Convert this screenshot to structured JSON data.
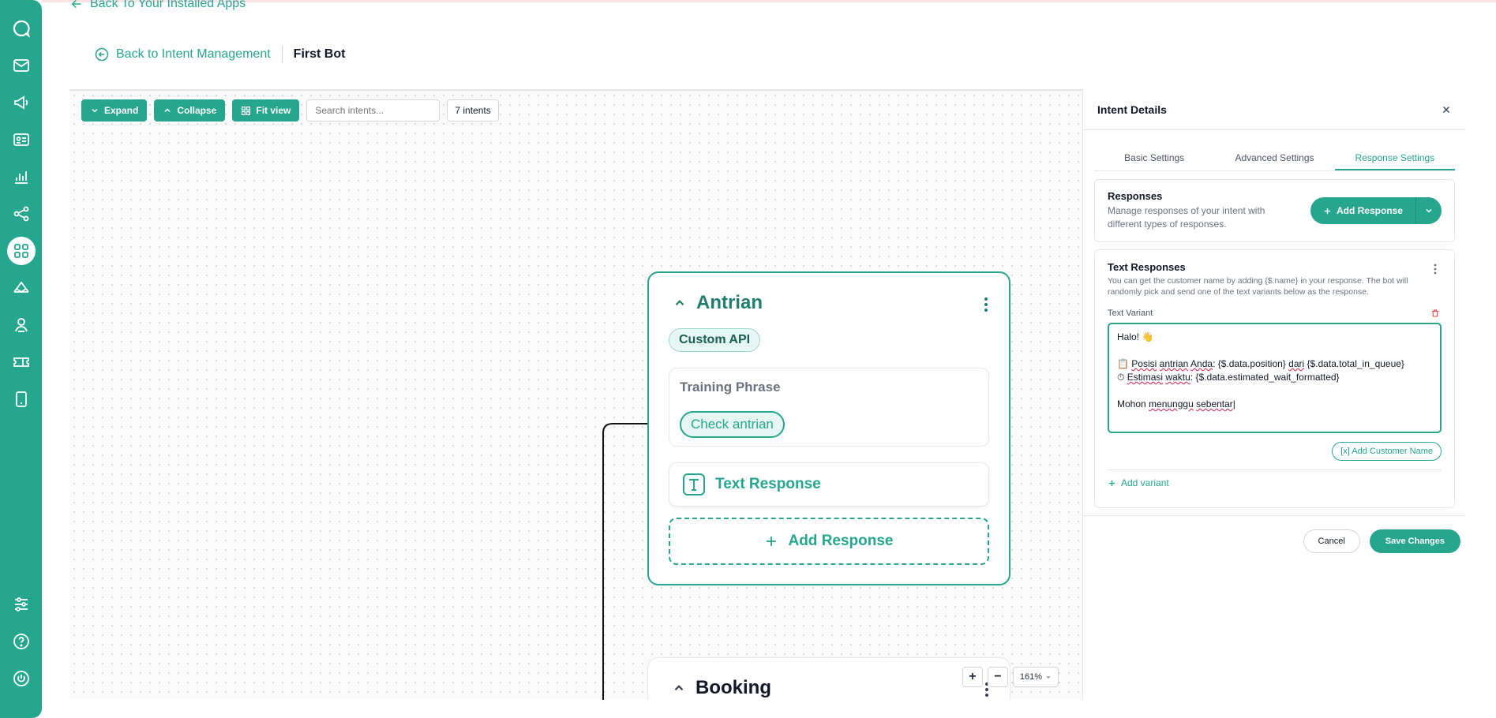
{
  "nav": {
    "back_apps": "Back To Your Installed Apps",
    "back_intent": "Back to Intent Management",
    "bot_name": "First Bot"
  },
  "sidebar": {
    "items": [
      "chat-logo-icon",
      "inbox-icon",
      "broadcast-icon",
      "contacts-icon",
      "analytics-icon",
      "integrations-icon",
      "apps-icon",
      "channels-icon",
      "agents-icon",
      "tickets-icon",
      "mobile-icon",
      "settings-icon",
      "help-icon",
      "power-icon"
    ],
    "active": "apps-icon",
    "color": "#26a68f"
  },
  "toolbar": {
    "expand": "Expand",
    "collapse": "Collapse",
    "fit_view": "Fit view",
    "search_placeholder": "Search intents...",
    "count": "7 intents"
  },
  "nodes": [
    {
      "title": "Antrian",
      "tag": "Custom API",
      "training_label": "Training Phrase",
      "training_phrase": "Check antrian",
      "response_label": "Text Response",
      "add_response": "Add Response"
    },
    {
      "title": "Booking"
    }
  ],
  "zoom": {
    "plus": "+",
    "minus": "−",
    "value": "161%"
  },
  "panel": {
    "title": "Intent Details",
    "tabs": [
      "Basic Settings",
      "Advanced Settings",
      "Response Settings"
    ],
    "active_tab": "Response Settings",
    "responses": {
      "title": "Responses",
      "desc": "Manage responses of your intent with different types of responses.",
      "add": "Add Response"
    },
    "text_responses": {
      "title": "Text Responses",
      "desc": "You can get the customer name by adding {$.name} in your response. The bot will randomly pick and send one of the text variants below as the response.",
      "variant_label": "Text Variant",
      "line1": "Halo! 👋",
      "line3_icon": "📋",
      "line3_a": "Posisi",
      "line3_b": "antrian",
      "line3_c": "Anda",
      "line3_d": ": {$.data.position} ",
      "line3_e": "dari",
      "line3_f": " {$.data.total_in_queue}",
      "line4_icon": "⏱",
      "line4_a": "Estimasi",
      "line4_b": "waktu",
      "line4_c": ": {$.data.estimated_wait_formatted}",
      "line6_a": "Mohon ",
      "line6_b": "menunggu",
      "line6_c": "sebentar",
      "add_customer": "[x] Add Customer Name",
      "add_variant": "Add variant"
    },
    "cancel": "Cancel",
    "save": "Save Changes"
  }
}
